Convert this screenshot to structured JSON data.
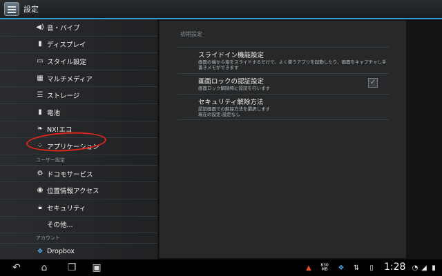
{
  "topbar": {
    "title": "設定",
    "accent": "#2e9fd6"
  },
  "settings_list": {
    "items_device": [
      {
        "label": "音・バイブ",
        "icon": "speaker-icon"
      },
      {
        "label": "ディスプレイ",
        "icon": "display-icon"
      },
      {
        "label": "スタイル設定",
        "icon": "style-icon"
      },
      {
        "label": "マルチメディア",
        "icon": "multimedia-icon"
      },
      {
        "label": "ストレージ",
        "icon": "storage-icon"
      },
      {
        "label": "電池",
        "icon": "battery-icon"
      },
      {
        "label": "NX!エコ",
        "icon": "leaf-icon"
      },
      {
        "label": "アプリケーション",
        "icon": "apps-icon"
      }
    ],
    "section_user": "ユーザー設定",
    "items_user": [
      {
        "label": "ドコモサービス",
        "icon": "docomo-icon"
      },
      {
        "label": "位置情報アクセス",
        "icon": "location-icon"
      },
      {
        "label": "セキュリティ",
        "icon": "lock-icon"
      },
      {
        "label": "その他...",
        "icon": ""
      }
    ],
    "section_account": "アカウント",
    "items_account": [
      {
        "label": "Dropbox",
        "icon": "dropbox-icon"
      }
    ]
  },
  "detail": {
    "section_title": "初期設定",
    "prefs": [
      {
        "title": "スライドイン機能設定",
        "summary": "画面の端から指をスライドするだけで、よく使うアプリを起動したり、画面をキャプチャし手書きメモができます",
        "checkbox": false
      },
      {
        "title": "画面ロックの認証設定",
        "summary": "画面ロック解除時に認証を行います",
        "checkbox": true,
        "checked": true
      },
      {
        "title": "セキュリティ解除方法",
        "summary": "認証画面での解除方法を選択します\n現在の設定:設定なし",
        "checkbox": false
      }
    ]
  },
  "statusbar": {
    "time": "1:28",
    "memory_top": "830",
    "memory_bottom": "MB",
    "icons": [
      "back-icon",
      "home-icon",
      "recent-apps-icon",
      "screenshot-icon",
      "notification-icon",
      "dropbox-icon",
      "usb-icon",
      "wifi-icon",
      "battery-icon"
    ]
  }
}
